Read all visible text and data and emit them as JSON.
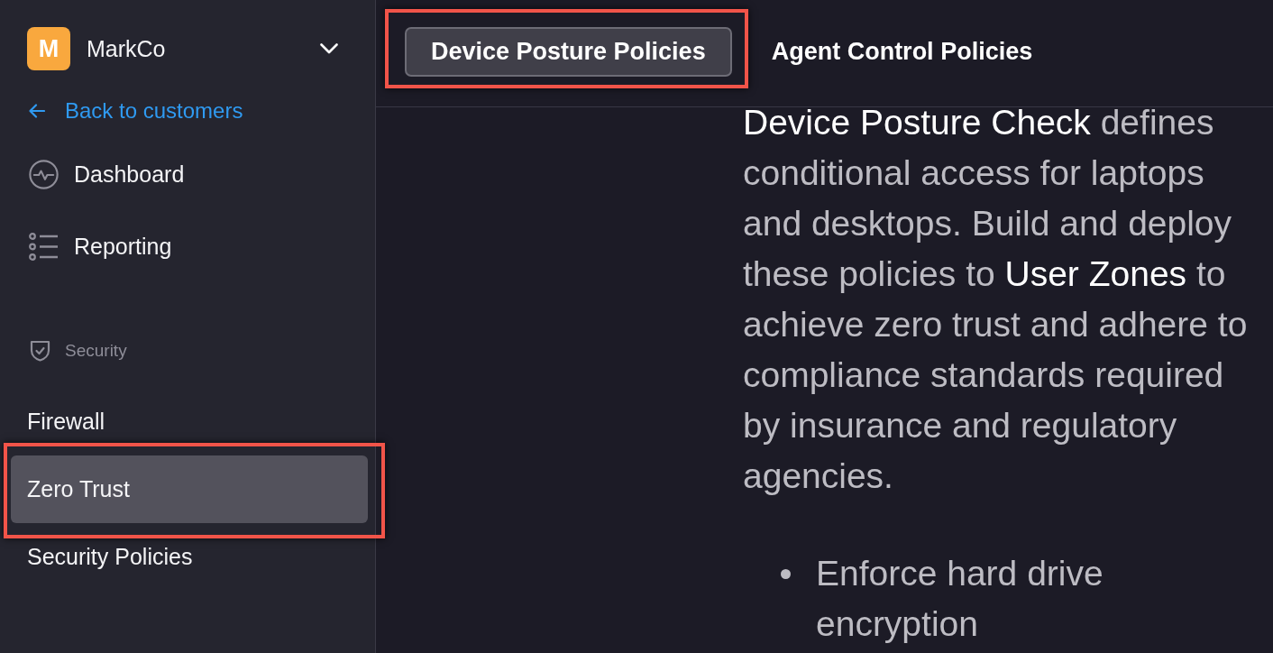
{
  "sidebar": {
    "account": {
      "initial": "M",
      "name": "MarkCo"
    },
    "back_link": "Back to customers",
    "nav": [
      {
        "label": "Dashboard",
        "selected": false
      },
      {
        "label": "Reporting",
        "selected": false
      }
    ],
    "section": {
      "title": "Security",
      "items": [
        {
          "label": "Firewall",
          "selected": false,
          "highlighted": false
        },
        {
          "label": "Zero Trust",
          "selected": true,
          "highlighted": true
        },
        {
          "label": "Security Policies",
          "selected": false,
          "highlighted": false
        }
      ]
    }
  },
  "tabs": [
    {
      "label": "Device Posture Policies",
      "selected": true,
      "highlighted": true
    },
    {
      "label": "Agent Control Policies",
      "selected": false,
      "highlighted": false
    }
  ],
  "content": {
    "paragraph": "**Device Posture Check** defines conditional access for laptops and desktops. Build and deploy these policies to **User Zones** to achieve zero trust and adhere to compliance standards required by insurance and regulatory agencies.",
    "bullets": [
      "Enforce hard drive encryption"
    ]
  }
}
